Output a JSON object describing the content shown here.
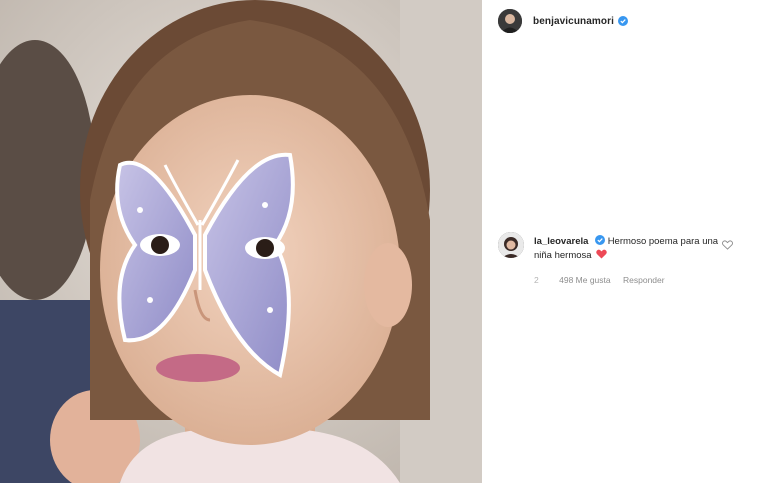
{
  "post": {
    "username": "benjavicunamori",
    "photo_alt": "Girl with butterfly face paint"
  },
  "comment": {
    "username": "la_leovarela",
    "text": "Hermoso poema para una niña hermosa",
    "time": "2",
    "likes": "498 Me gusta",
    "reply": "Responder"
  },
  "colors": {
    "verified": "#3897f0",
    "heart": "#ed4956",
    "text": "#262626",
    "muted": "#8e8e8e"
  },
  "icons": [
    "verified-badge-icon",
    "heart-emoji-icon",
    "like-heart-icon"
  ]
}
